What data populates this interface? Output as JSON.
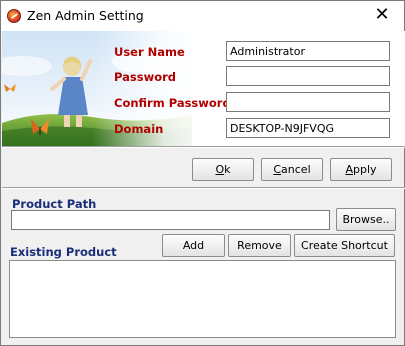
{
  "window": {
    "title": "Zen Admin Setting",
    "close_glyph": "✕"
  },
  "fields": {
    "user_name_label": "User Name",
    "user_name_value": "Administrator",
    "password_label": "Password",
    "password_value": "",
    "confirm_password_label": "Confirm Password",
    "confirm_password_value": "",
    "domain_label": "Domain",
    "domain_value": "DESKTOP-N9JFVQG"
  },
  "dialog_buttons": {
    "ok_u": "O",
    "ok_rest": "k",
    "cancel_u": "C",
    "cancel_rest": "ancel",
    "apply_u": "A",
    "apply_rest": "pply"
  },
  "product": {
    "path_label": "Product Path",
    "path_value": "",
    "browse_label": "Browse..",
    "existing_label": "Existing Product",
    "add_label": "Add",
    "remove_label": "Remove",
    "create_shortcut_label": "Create Shortcut",
    "items": []
  },
  "colors": {
    "field_label": "#b00000",
    "section_label": "#1a2e7a",
    "window_bg": "#f0f0f0"
  },
  "icons": [
    "zen-app-icon",
    "close-icon"
  ]
}
